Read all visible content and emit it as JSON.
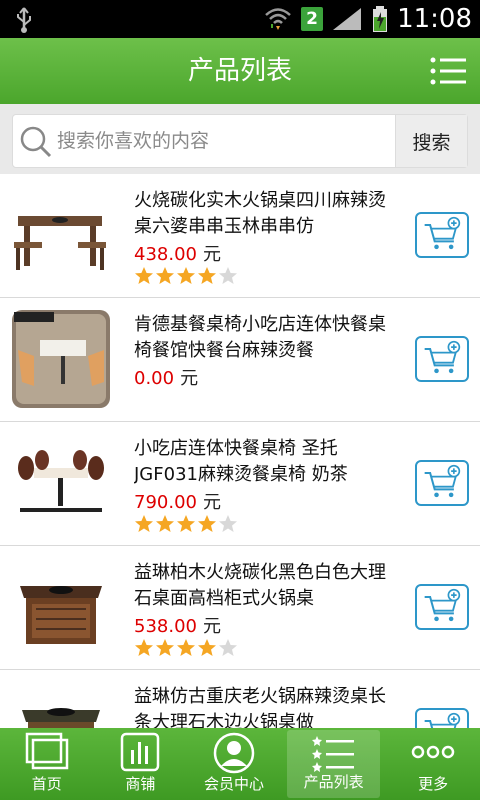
{
  "status_bar": {
    "time": "11:08",
    "sim": "2"
  },
  "header": {
    "title": "产品列表"
  },
  "search": {
    "placeholder": "搜索你喜欢的内容",
    "button_label": "搜索"
  },
  "products": [
    {
      "name": "火烧碳化实木火锅桌四川麻辣烫桌六婆串串玉林串串仿",
      "price": "438.00",
      "unit": "元",
      "rating": 4
    },
    {
      "name": "肯德基餐桌椅小吃店连体快餐桌椅餐馆快餐台麻辣烫餐",
      "price": "0.00",
      "unit": "元",
      "rating": 0
    },
    {
      "name": "小吃店连体快餐桌椅 圣托JGF031麻辣烫餐桌椅 奶茶",
      "price": "790.00",
      "unit": "元",
      "rating": 4
    },
    {
      "name": "益琳柏木火烧碳化黑色白色大理石桌面高档柜式火锅桌",
      "price": "538.00",
      "unit": "元",
      "rating": 4
    },
    {
      "name": "益琳仿古重庆老火锅麻辣烫桌长条大理石木边火锅桌做",
      "price": "",
      "unit": "",
      "rating": 0
    }
  ],
  "bottom_nav": [
    {
      "label": "首页",
      "icon": "home-icon"
    },
    {
      "label": "商铺",
      "icon": "shop-icon"
    },
    {
      "label": "会员中心",
      "icon": "member-icon"
    },
    {
      "label": "产品列表",
      "icon": "product-list-icon",
      "active": true
    },
    {
      "label": "更多",
      "icon": "more-icon"
    }
  ],
  "colors": {
    "brand_green": "#4ba62c",
    "price_red": "#dd0000",
    "cart_blue": "#2d97c9",
    "star_orange": "#f5a623"
  }
}
